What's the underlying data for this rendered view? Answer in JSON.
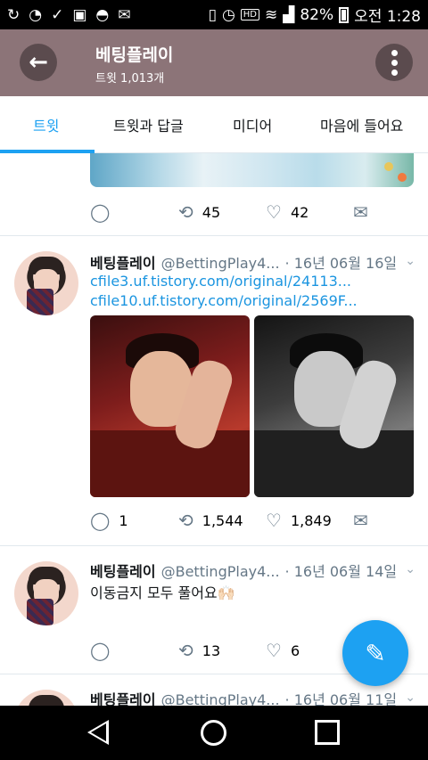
{
  "status_bar": {
    "battery": "82%",
    "time": "오전 1:28",
    "hd": "HD",
    "icons": [
      "sync-icon",
      "circle-app-icon",
      "check-icon",
      "image-icon",
      "spy-icon",
      "mail-icon",
      "vibrate-icon",
      "alarm-icon",
      "wifi-icon",
      "signal-icon",
      "battery-icon"
    ]
  },
  "header": {
    "title": "베팅플레이",
    "subtitle": "트윗 1,013개",
    "back_icon": "arrow-left-icon",
    "more_icon": "more-vertical-icon",
    "background": "#8c7478"
  },
  "tabs": [
    {
      "label": "트윗",
      "active": true
    },
    {
      "label": "트윗과 답글",
      "active": false
    },
    {
      "label": "미디어",
      "active": false
    },
    {
      "label": "마음에 들어요",
      "active": false
    }
  ],
  "accent": "#1da1f2",
  "tweets": [
    {
      "replies": "",
      "retweets": "45",
      "likes": "42"
    },
    {
      "name": "베팅플레이",
      "handle": "@BettingPlay4...",
      "date": "· 16년 06월 16일",
      "links": [
        "cfile3.uf.tistory.com/original/24113...",
        "cfile10.uf.tistory.com/original/2569F..."
      ],
      "replies": "1",
      "retweets": "1,544",
      "likes": "1,849"
    },
    {
      "name": "베팅플레이",
      "handle": "@BettingPlay4...",
      "date": "· 16년 06월 14일",
      "text": "이동금지 모두 풀어요🙌🏻",
      "replies": "",
      "retweets": "13",
      "likes": "6"
    },
    {
      "name": "베팅플레이",
      "handle": "@BettingPlay4...",
      "date": "· 16년 06월 11일"
    }
  ],
  "fab_icon": "compose-feather-icon",
  "nav": [
    "back-icon",
    "home-icon",
    "recents-icon"
  ]
}
